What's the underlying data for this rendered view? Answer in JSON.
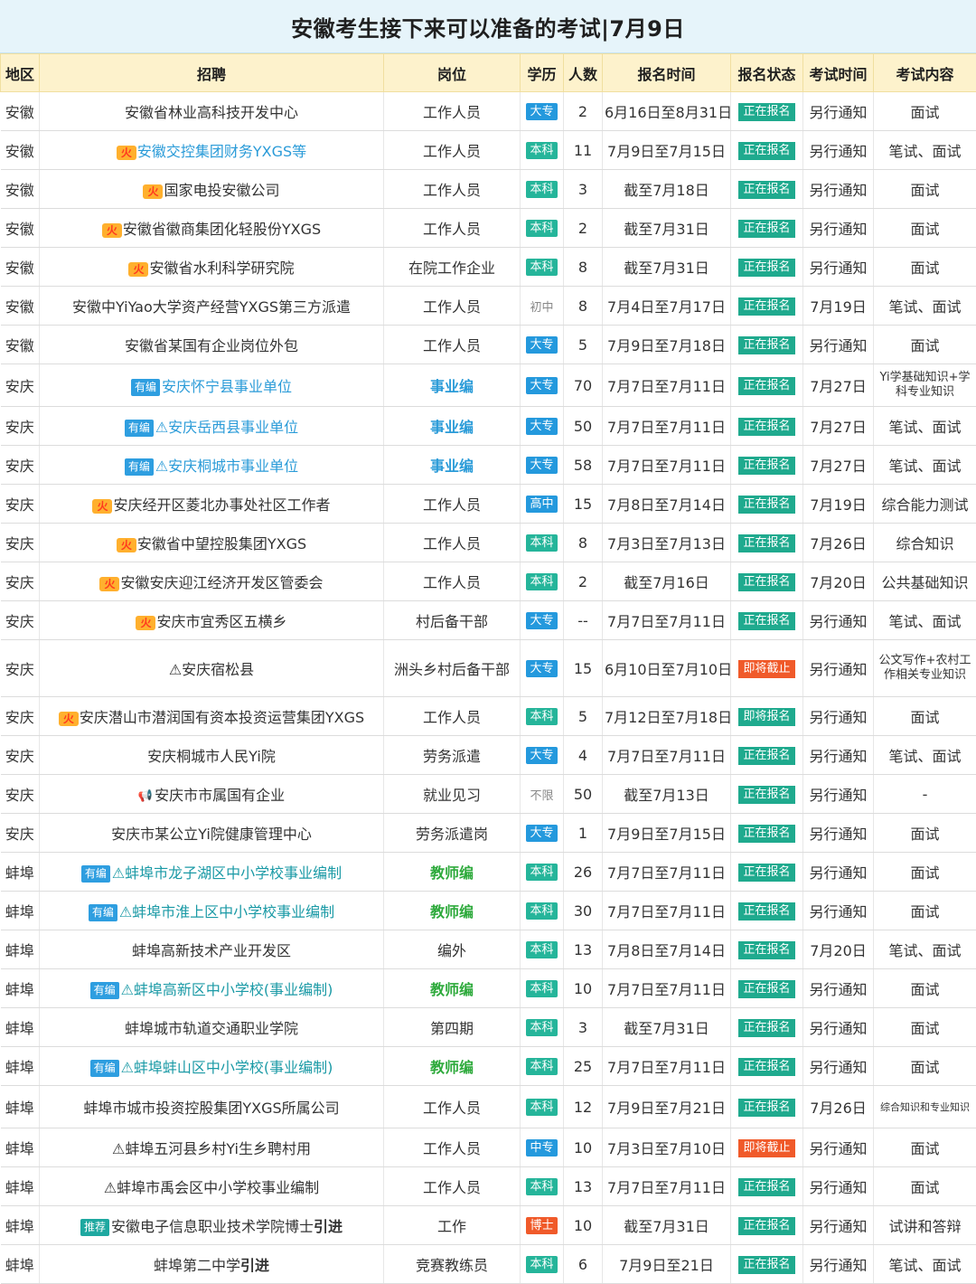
{
  "title": "安徽考生接下来可以准备的考试|7月9日",
  "headers": [
    "地区",
    "招聘",
    "岗位",
    "学历",
    "人数",
    "报名时间",
    "报名状态",
    "考试时间",
    "考试内容"
  ],
  "rows": [
    {
      "region": "安徽",
      "name": "安徽省林业高科技开发中心",
      "post": "工作人员",
      "edu": "大专",
      "num": "2",
      "signup": "6月16日至8月31日",
      "status": "正在报名",
      "exam": "另行通知",
      "content": "面试"
    },
    {
      "region": "安徽",
      "name": "安徽交控集团财务YXGS等",
      "post": "工作人员",
      "edu": "本科",
      "num": "11",
      "signup": "7月9日至7月15日",
      "status": "正在报名",
      "exam": "另行通知",
      "content": "笔试、面试"
    },
    {
      "region": "安徽",
      "name": "国家电投安徽公司",
      "post": "工作人员",
      "edu": "本科",
      "num": "3",
      "signup": "截至7月18日",
      "status": "正在报名",
      "exam": "另行通知",
      "content": "面试"
    },
    {
      "region": "安徽",
      "name": "安徽省徽商集团化轻股份YXGS",
      "post": "工作人员",
      "edu": "本科",
      "num": "2",
      "signup": "截至7月31日",
      "status": "正在报名",
      "exam": "另行通知",
      "content": "面试"
    },
    {
      "region": "安徽",
      "name": "安徽省水利科学研究院",
      "post": "在院工作企业",
      "edu": "本科",
      "num": "8",
      "signup": "截至7月31日",
      "status": "正在报名",
      "exam": "另行通知",
      "content": "面试"
    },
    {
      "region": "安徽",
      "name": "安徽中YiYao大学资产经营YXGS第三方派遣",
      "post": "工作人员",
      "edu": "初中",
      "num": "8",
      "signup": "7月4日至7月17日",
      "status": "正在报名",
      "exam": "7月19日",
      "content": "笔试、面试"
    },
    {
      "region": "安徽",
      "name": "安徽省某国有企业岗位外包",
      "post": "工作人员",
      "edu": "大专",
      "num": "5",
      "signup": "7月9日至7月18日",
      "status": "正在报名",
      "exam": "另行通知",
      "content": "面试"
    },
    {
      "region": "安庆",
      "name": "安庆怀宁县事业单位",
      "post": "事业编",
      "edu": "大专",
      "num": "70",
      "signup": "7月7日至7月11日",
      "status": "正在报名",
      "exam": "7月27日",
      "content": "Yi学基础知识+学科专业知识"
    },
    {
      "region": "安庆",
      "name": "⚠安庆岳西县事业单位",
      "post": "事业编",
      "edu": "大专",
      "num": "50",
      "signup": "7月7日至7月11日",
      "status": "正在报名",
      "exam": "7月27日",
      "content": "笔试、面试"
    },
    {
      "region": "安庆",
      "name": "⚠安庆桐城市事业单位",
      "post": "事业编",
      "edu": "大专",
      "num": "58",
      "signup": "7月7日至7月11日",
      "status": "正在报名",
      "exam": "7月27日",
      "content": "笔试、面试"
    },
    {
      "region": "安庆",
      "name": "安庆经开区菱北办事处社区工作者",
      "post": "工作人员",
      "edu": "高中",
      "num": "15",
      "signup": "7月8日至7月14日",
      "status": "正在报名",
      "exam": "7月19日",
      "content": "综合能力测试"
    },
    {
      "region": "安庆",
      "name": "安徽省中望控股集团YXGS",
      "post": "工作人员",
      "edu": "本科",
      "num": "8",
      "signup": "7月3日至7月13日",
      "status": "正在报名",
      "exam": "7月26日",
      "content": "综合知识"
    },
    {
      "region": "安庆",
      "name": "安徽安庆迎江经济开发区管委会",
      "post": "工作人员",
      "edu": "本科",
      "num": "2",
      "signup": "截至7月16日",
      "status": "正在报名",
      "exam": "7月20日",
      "content": "公共基础知识"
    },
    {
      "region": "安庆",
      "name": "安庆市宜秀区五横乡",
      "post": "村后备干部",
      "edu": "大专",
      "num": "--",
      "signup": "7月7日至7月11日",
      "status": "正在报名",
      "exam": "另行通知",
      "content": "笔试、面试"
    },
    {
      "region": "安庆",
      "name": "⚠安庆宿松县",
      "post": "洲头乡村后备干部",
      "edu": "大专",
      "num": "15",
      "signup": "6月10日至7月10日",
      "status": "即将截止",
      "exam": "另行通知",
      "content": "公文写作+农村工作相关专业知识"
    },
    {
      "region": "安庆",
      "name": "安庆潜山市潜润国有资本投资运营集团YXGS",
      "post": "工作人员",
      "edu": "本科",
      "num": "5",
      "signup": "7月12日至7月18日",
      "status": "即将报名",
      "exam": "另行通知",
      "content": "面试"
    },
    {
      "region": "安庆",
      "name": "安庆桐城市人民Yi院",
      "post": "劳务派遣",
      "edu": "大专",
      "num": "4",
      "signup": "7月7日至7月11日",
      "status": "正在报名",
      "exam": "另行通知",
      "content": "笔试、面试"
    },
    {
      "region": "安庆",
      "name": "安庆市市属国有企业",
      "post": "就业见习",
      "edu": "不限",
      "num": "50",
      "signup": "截至7月13日",
      "status": "正在报名",
      "exam": "另行通知",
      "content": "-"
    },
    {
      "region": "安庆",
      "name": "安庆市某公立Yi院健康管理中心",
      "post": "劳务派遣岗",
      "edu": "大专",
      "num": "1",
      "signup": "7月9日至7月15日",
      "status": "正在报名",
      "exam": "另行通知",
      "content": "面试"
    },
    {
      "region": "蚌埠",
      "name": "⚠蚌埠市龙子湖区中小学校事业编制",
      "post": "教师编",
      "edu": "本科",
      "num": "26",
      "signup": "7月7日至7月11日",
      "status": "正在报名",
      "exam": "另行通知",
      "content": "面试"
    },
    {
      "region": "蚌埠",
      "name": "⚠蚌埠市淮上区中小学校事业编制",
      "post": "教师编",
      "edu": "本科",
      "num": "30",
      "signup": "7月7日至7月11日",
      "status": "正在报名",
      "exam": "另行通知",
      "content": "面试"
    },
    {
      "region": "蚌埠",
      "name": "蚌埠高新技术产业开发区",
      "post": "编外",
      "edu": "本科",
      "num": "13",
      "signup": "7月8日至7月14日",
      "status": "正在报名",
      "exam": "7月20日",
      "content": "笔试、面试"
    },
    {
      "region": "蚌埠",
      "name": "⚠蚌埠高新区中小学校(事业编制)",
      "post": "教师编",
      "edu": "本科",
      "num": "10",
      "signup": "7月7日至7月11日",
      "status": "正在报名",
      "exam": "另行通知",
      "content": "面试"
    },
    {
      "region": "蚌埠",
      "name": "蚌埠城市轨道交通职业学院",
      "post": "第四期",
      "edu": "本科",
      "num": "3",
      "signup": "截至7月31日",
      "status": "正在报名",
      "exam": "另行通知",
      "content": "面试"
    },
    {
      "region": "蚌埠",
      "name": "⚠蚌埠蚌山区中小学校(事业编制)",
      "post": "教师编",
      "edu": "本科",
      "num": "25",
      "signup": "7月7日至7月11日",
      "status": "正在报名",
      "exam": "另行通知",
      "content": "面试"
    },
    {
      "region": "蚌埠",
      "name": "蚌埠市城市投资控股集团YXGS所属公司",
      "post": "工作人员",
      "edu": "本科",
      "num": "12",
      "signup": "7月9日至7月21日",
      "status": "正在报名",
      "exam": "7月26日",
      "content": "综合知识和专业知识"
    },
    {
      "region": "蚌埠",
      "name": "⚠蚌埠五河县乡村Yi生乡聘村用",
      "post": "工作人员",
      "edu": "中专",
      "num": "10",
      "signup": "7月3日至7月10日",
      "status": "即将截止",
      "exam": "另行通知",
      "content": "面试"
    },
    {
      "region": "蚌埠",
      "name": "⚠蚌埠市禹会区中小学校事业编制",
      "post": "工作人员",
      "edu": "本科",
      "num": "13",
      "signup": "7月7日至7月11日",
      "status": "正在报名",
      "exam": "另行通知",
      "content": "面试"
    },
    {
      "region": "蚌埠",
      "name": "安徽电子信息职业技术学院博士",
      "post": "工作",
      "edu": "博士",
      "num": "10",
      "signup": "截至7月31日",
      "status": "正在报名",
      "exam": "另行通知",
      "content": "试讲和答辩"
    },
    {
      "region": "蚌埠",
      "name": "蚌埠第二中学",
      "post": "竞赛教练员",
      "edu": "本科",
      "num": "6",
      "signup": "7月9日至21日",
      "status": "正在报名",
      "exam": "另行通知",
      "content": "笔试、面试"
    }
  ],
  "labels": {
    "tag_youbian": "有编",
    "tag_tuijian": "推荐",
    "fire_icon": "火",
    "yinjin": "引进"
  }
}
